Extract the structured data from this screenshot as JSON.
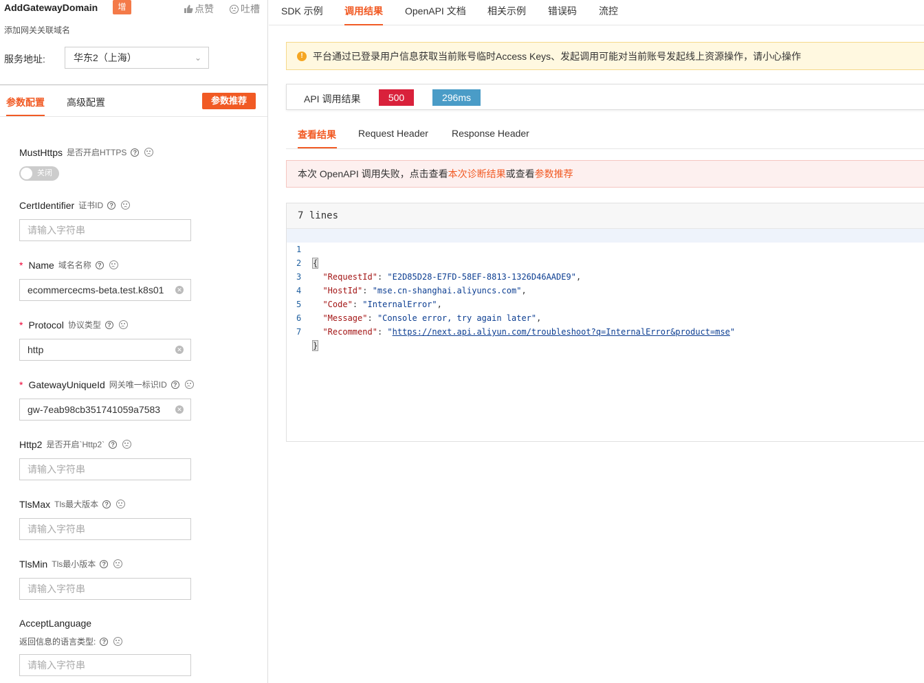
{
  "api": {
    "title": "AddGatewayDomain",
    "badge": "增",
    "like_label": "点赞",
    "complain_label": "吐槽",
    "description": "添加网关关联域名",
    "service_label": "服务地址:",
    "region_value": "华东2（上海）"
  },
  "param_tabs": {
    "params": "参数配置",
    "advanced": "高级配置",
    "recommend_button": "参数推荐"
  },
  "fields": {
    "must_https": {
      "name": "MustHttps",
      "desc": "是否开启HTTPS",
      "toggle_text": "关闭"
    },
    "cert_identifier": {
      "name": "CertIdentifier",
      "desc": "证书ID",
      "placeholder": "请输入字符串"
    },
    "name": {
      "name": "Name",
      "desc": "域名名称",
      "value": "ecommercecms-beta.test.k8s01"
    },
    "protocol": {
      "name": "Protocol",
      "desc": "协议类型",
      "value": "http"
    },
    "gateway_unique_id": {
      "name": "GatewayUniqueId",
      "desc": "网关唯一标识ID",
      "value": "gw-7eab98cb351741059a7583"
    },
    "http2": {
      "name": "Http2",
      "desc": "是否开启`Http2`",
      "placeholder": "请输入字符串"
    },
    "tls_max": {
      "name": "TlsMax",
      "desc": "Tls最大版本",
      "placeholder": "请输入字符串"
    },
    "tls_min": {
      "name": "TlsMin",
      "desc": "Tls最小版本",
      "placeholder": "请输入字符串"
    },
    "accept_language": {
      "name": "AcceptLanguage",
      "desc": "返回信息的语言类型:",
      "placeholder": "请输入字符串"
    }
  },
  "top_tabs": [
    "SDK 示例",
    "调用结果",
    "OpenAPI 文档",
    "相关示例",
    "错误码",
    "流控"
  ],
  "notice": "平台通过已登录用户信息获取当前账号临时Access Keys、发起调用可能对当前账号发起线上资源操作，请小心操作",
  "result": {
    "label": "API 调用结果",
    "status": "500",
    "time": "296ms"
  },
  "sub_tabs": [
    "查看结果",
    "Request Header",
    "Response Header"
  ],
  "error_banner": {
    "prefix": "本次 OpenAPI 调用失败，点击查看",
    "link1": "本次诊断结果",
    "middle": "或查看",
    "link2": "参数推荐"
  },
  "code": {
    "header": "7 lines",
    "line_numbers": [
      "1",
      "2",
      "3",
      "4",
      "5",
      "6",
      "7"
    ],
    "request_id_key": "\"RequestId\"",
    "request_id_val": "\"E2D85D28-E7FD-58EF-8813-1326D46AADE9\"",
    "host_id_key": "\"HostId\"",
    "host_id_val": "\"mse.cn-shanghai.aliyuncs.com\"",
    "code_key": "\"Code\"",
    "code_val": "\"InternalError\"",
    "message_key": "\"Message\"",
    "message_val": "\"Console error, try again later\"",
    "recommend_key": "\"Recommend\"",
    "recommend_url": "https://next.api.aliyun.com/troubleshoot?q=InternalError&product=mse"
  },
  "colors": {
    "accent": "#f15a24",
    "status_error": "#d9213b",
    "time_badge": "#4a9cc7"
  }
}
